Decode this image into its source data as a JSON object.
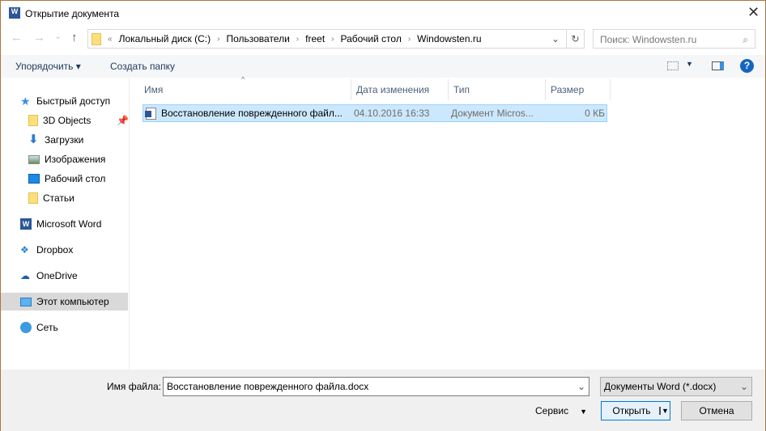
{
  "window": {
    "title": "Открытие документа",
    "close": "✕"
  },
  "nav": {
    "back": "←",
    "forward": "→",
    "recent": "⌄",
    "up": "↑"
  },
  "address": {
    "overflow": "«",
    "crumbs": [
      "Локальный диск (C:)",
      "Пользователи",
      "freet",
      "Рабочий стол",
      "Windowsten.ru"
    ],
    "dropdown": "⌄",
    "refresh": "↻"
  },
  "search": {
    "placeholder": "Поиск: Windowsten.ru",
    "icon": "⌕"
  },
  "toolbar": {
    "organize": "Упорядочить ▾",
    "new_folder": "Создать папку",
    "help": "?"
  },
  "sidebar": {
    "items": [
      {
        "label": "Быстрый доступ",
        "icon": "star-icon"
      },
      {
        "label": "3D Objects",
        "icon": "folder-icon"
      },
      {
        "label": "Загрузки",
        "icon": "download-icon"
      },
      {
        "label": "Изображения",
        "icon": "pictures-icon"
      },
      {
        "label": "Рабочий стол",
        "icon": "desktop-icon"
      },
      {
        "label": "Статьи",
        "icon": "folder-icon"
      },
      {
        "label": "Microsoft Word",
        "icon": "word-icon"
      },
      {
        "label": "Dropbox",
        "icon": "dropbox-icon"
      },
      {
        "label": "OneDrive",
        "icon": "onedrive-icon"
      },
      {
        "label": "Этот компьютер",
        "icon": "computer-icon"
      },
      {
        "label": "Сеть",
        "icon": "network-icon"
      }
    ]
  },
  "columns": [
    "Имя",
    "Дата изменения",
    "Тип",
    "Размер"
  ],
  "files": [
    {
      "name": "Восстановление поврежденного файл...",
      "date": "04.10.2016 16:33",
      "type": "Документ Micros...",
      "size": "0 КБ"
    }
  ],
  "footer": {
    "filename_label": "Имя файла:",
    "filename": "Восстановление поврежденного файла.docx",
    "filetype": "Документы Word (*.docx)",
    "tools": "Сервис",
    "open": "Открыть",
    "cancel": "Отмена"
  },
  "colors": {
    "accent": "#0078d7",
    "selection": "#cce8ff",
    "border": "#b0743a"
  }
}
